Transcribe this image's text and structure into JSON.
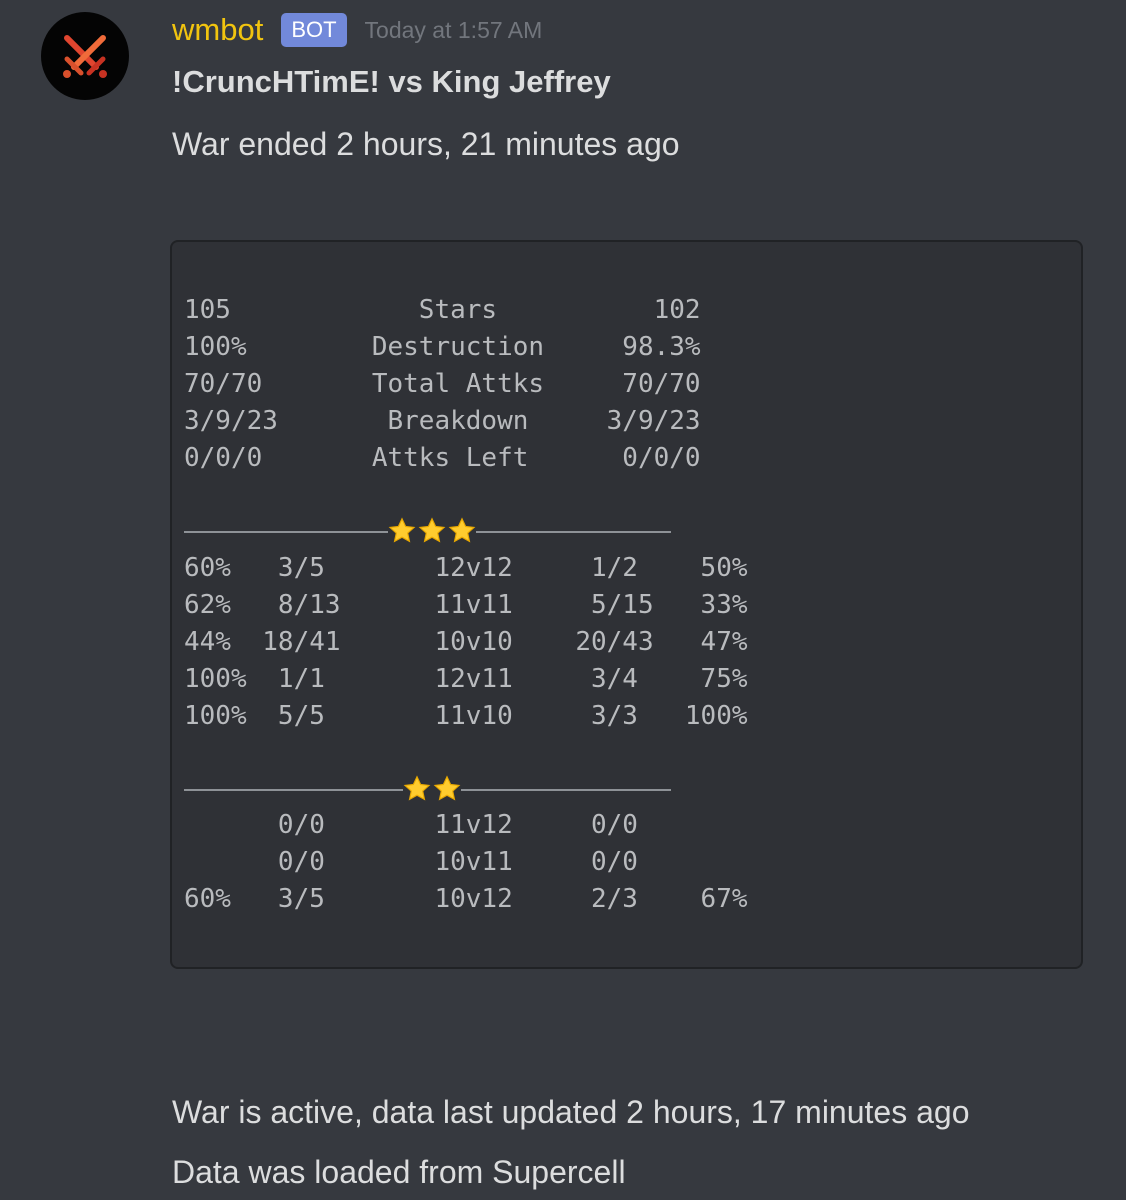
{
  "message": {
    "author": "wmbot",
    "badge": "BOT",
    "timestamp": "Today at 1:57 AM",
    "avatar_icon": "crossed-swords-icon",
    "title": "!CruncHTimE! vs King Jeffrey",
    "subtitle": "War ended 2 hours, 21 minutes ago"
  },
  "code": {
    "summary": [
      "105            Stars          102",
      "100%        Destruction     98.3%",
      "70/70       Total Attks     70/70",
      "3/9/23       Breakdown     3/9/23",
      "0/0/0       Attks Left      0/0/0"
    ],
    "three_star_rows": [
      "60%   3/5       12v12     1/2    50%",
      "62%   8/13      11v11     5/15   33%",
      "44%  18/41      10v10    20/43   47%",
      "100%  1/1       12v11     3/4    75%",
      "100%  5/5       11v10     3/3   100%"
    ],
    "two_star_rows": [
      "      0/0       11v12     0/0",
      "      0/0       10v11     0/0",
      "60%   3/5       10v12     2/3    67%"
    ]
  },
  "footer": {
    "line1": "War is active, data last updated 2 hours, 17 minutes ago",
    "line2": "Data was loaded from Supercell"
  },
  "colors": {
    "background": "#36393f",
    "codeblock": "#2f3136",
    "username": "#f1c40f",
    "badge": "#7289da",
    "star": "#ffcc2e"
  }
}
